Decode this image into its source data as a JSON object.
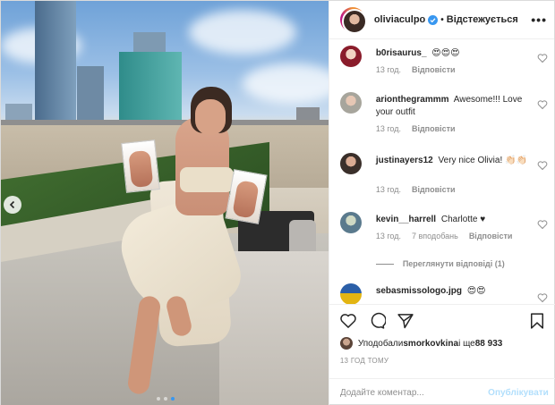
{
  "post": {
    "username": "oliviaculpo",
    "separator": "•",
    "follow_state": "Відстежується",
    "more_glyph": "•••"
  },
  "comments": [
    {
      "username": "b0risaurus_",
      "text": "😍😍😍",
      "time": "13 год.",
      "likes": "",
      "reply_label": "Відповісти",
      "avatar_color": "#8a1c2b"
    },
    {
      "username": "arionthegrammm",
      "text": "Awesome!!! Love your outfit",
      "time": "13 год.",
      "likes": "",
      "reply_label": "Відповісти",
      "avatar_color": "#a7a59c"
    },
    {
      "username": "justinayers12",
      "text": "Very nice Olivia! 👏🏻👏🏻",
      "time": "13 год.",
      "likes": "",
      "reply_label": "Відповісти",
      "avatar_color": "#3a2f2a"
    },
    {
      "username": "kevin__harrell",
      "text": "Charlotte ♥",
      "time": "13 год.",
      "likes": "7 вподобань",
      "reply_label": "Відповісти",
      "avatar_color": "#5a7a8d"
    },
    {
      "username": "sebasmissologo.jpg",
      "text": "😍😍",
      "time": "",
      "likes": "",
      "reply_label": "",
      "avatar_color": "#e3b512"
    }
  ],
  "view_replies": "Переглянути відповіді (1)",
  "likes": {
    "prefix": "Уподобали ",
    "user": "smorkovkina",
    "middle": " і ще ",
    "count": "88 933"
  },
  "timestamp": "13 ГОД ТОМУ",
  "add_comment": {
    "placeholder": "Додайте коментар...",
    "publish_label": "Опублікувати"
  },
  "colors": {
    "accent": "#3897f0",
    "verified": "#3897f0",
    "publish_disabled": "#b2dffc",
    "muted": "#8e8e8e"
  },
  "carousel": {
    "count": 3,
    "active": 3
  }
}
